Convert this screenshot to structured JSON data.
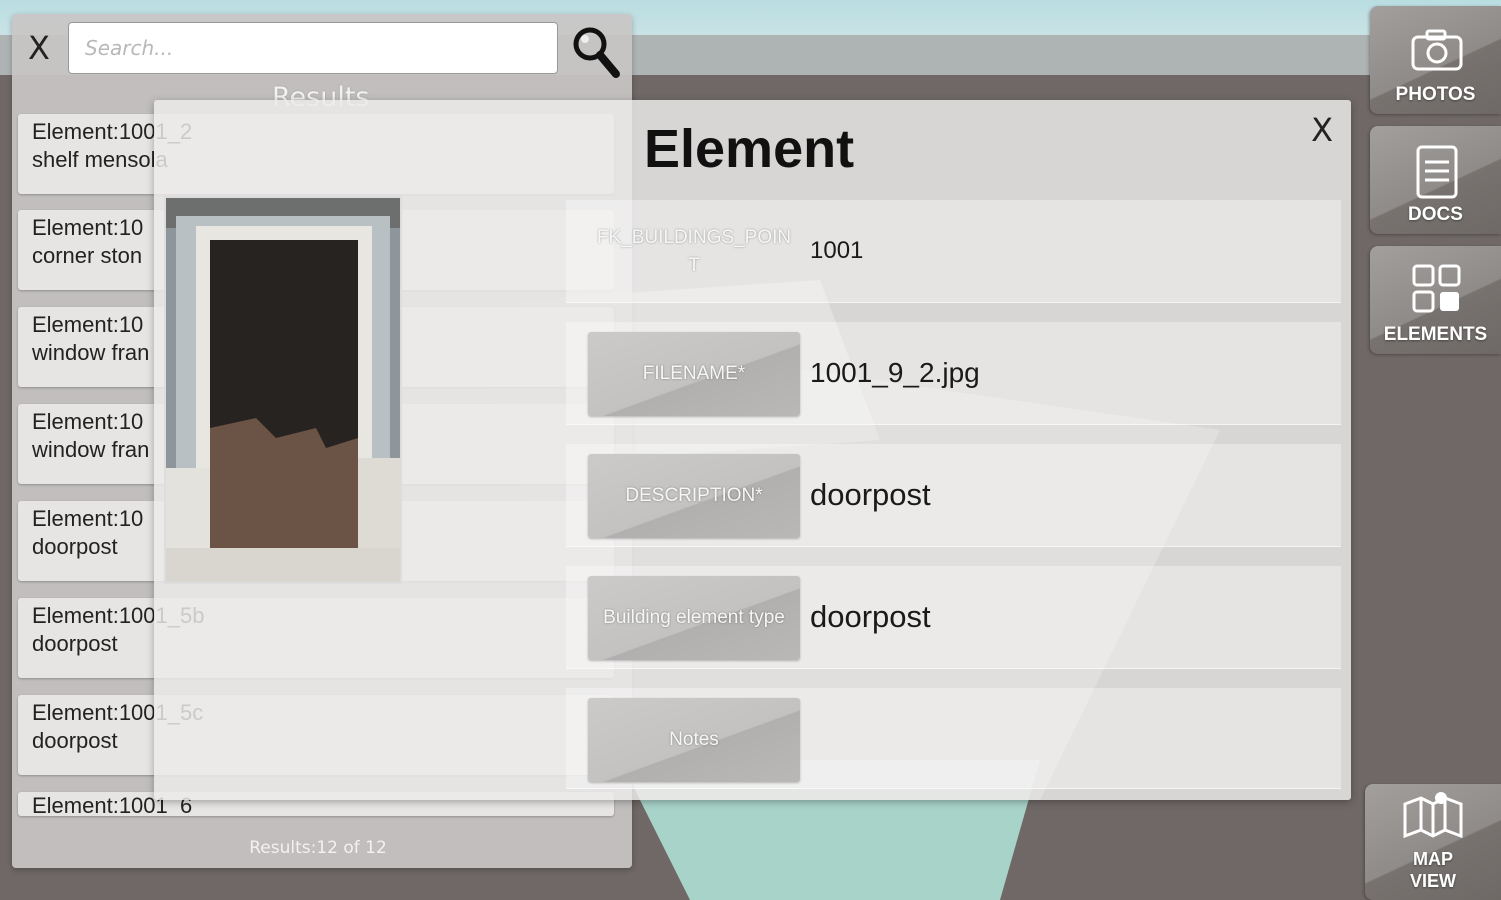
{
  "search": {
    "close_label": "X",
    "placeholder": "Search..."
  },
  "results": {
    "title": "Results",
    "items": [
      {
        "id": "Element:1001_2",
        "name": "shelf mensola"
      },
      {
        "id": "Element:10",
        "name": "corner ston"
      },
      {
        "id": "Element:10",
        "name": "window fran"
      },
      {
        "id": "Element:10",
        "name": "window fran"
      },
      {
        "id": "Element:10",
        "name": "doorpost"
      },
      {
        "id": "Element:1001_5b",
        "name": "doorpost"
      },
      {
        "id": "Element:1001_5c",
        "name": "doorpost"
      },
      {
        "id": "Element:1001_6",
        "name": ""
      }
    ],
    "footer": "Results:12 of 12"
  },
  "dialog": {
    "title": "Element",
    "close_label": "X",
    "fields": [
      {
        "label": "FK_BUILDINGS_POINT",
        "value": "1001"
      },
      {
        "label": "FILENAME*",
        "value": "1001_9_2.jpg"
      },
      {
        "label": "DESCRIPTION*",
        "value": "doorpost"
      },
      {
        "label": "Building element type",
        "value": "doorpost"
      },
      {
        "label": "Notes",
        "value": ""
      }
    ]
  },
  "toolbar": {
    "photos_label": "PHOTOS",
    "docs_label": "DOCS",
    "elements_label": "ELEMENTS",
    "mapview_label": "MAP VIEW"
  },
  "icons": {
    "camera": "camera-icon",
    "document": "document-icon",
    "grid": "grid-icon",
    "map": "map-icon",
    "search": "search-icon"
  },
  "colors": {
    "background": "#6f6866",
    "panel": "#c8c6c4",
    "dialog": "#ecebea",
    "ground_teal": "#a8d3c9"
  }
}
